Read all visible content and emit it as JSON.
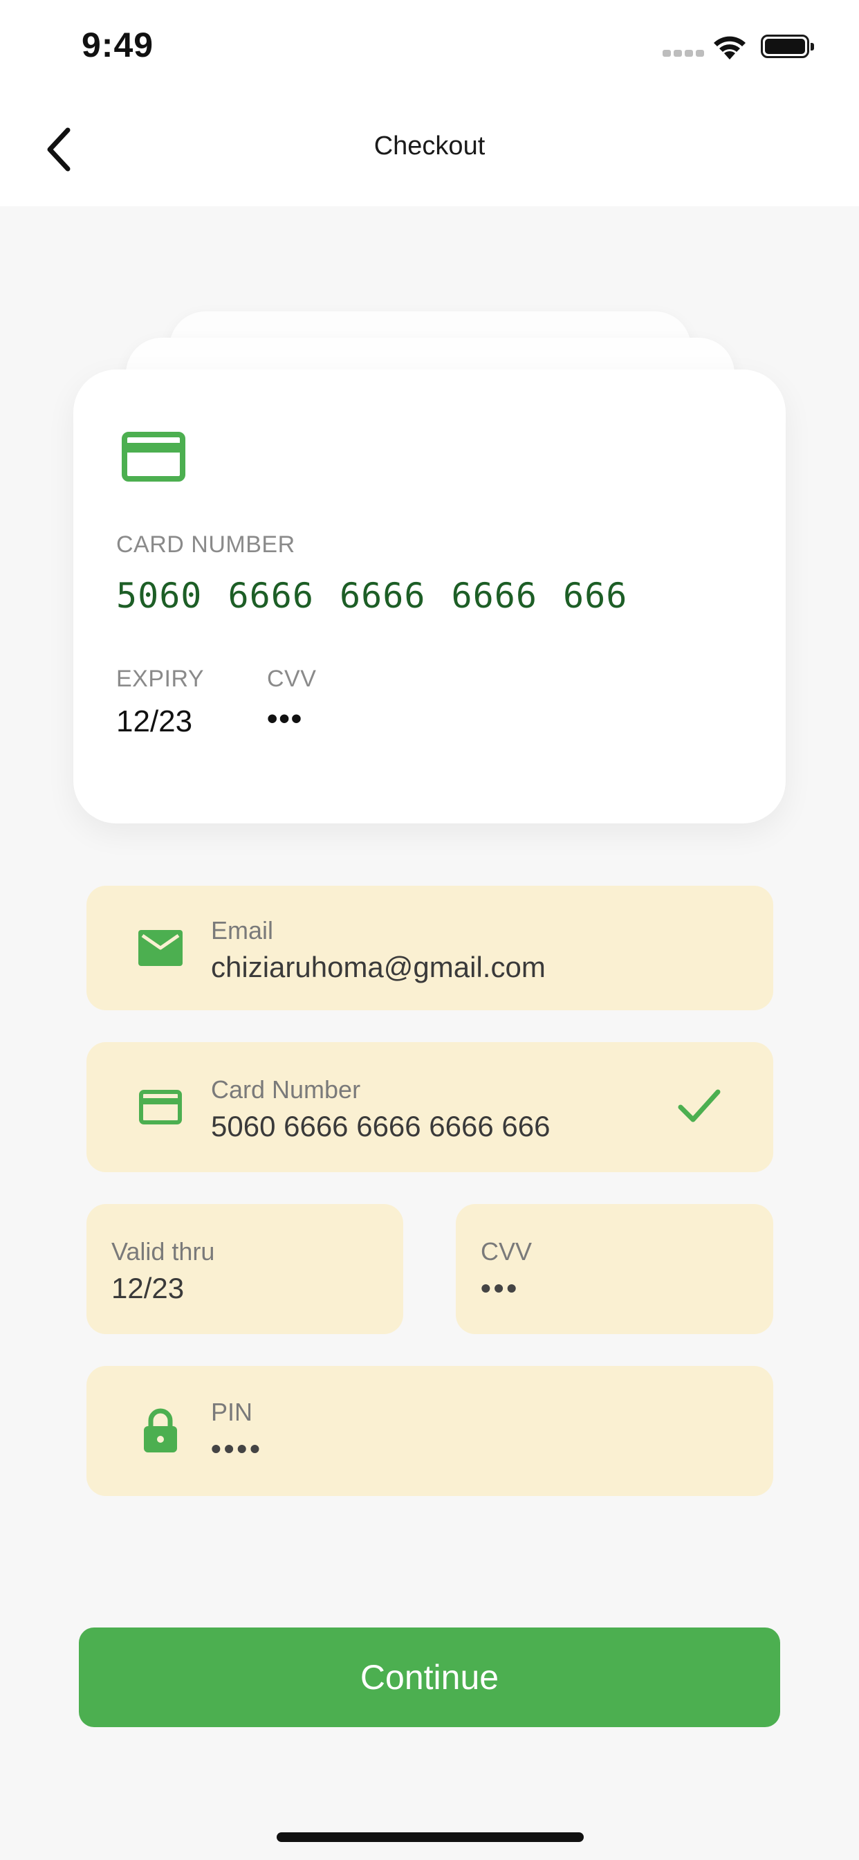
{
  "status_bar": {
    "time": "9:49"
  },
  "header": {
    "title": "Checkout",
    "back_icon": "chevron-left-icon"
  },
  "card_preview": {
    "icon": "credit-card-icon",
    "number_label": "CARD NUMBER",
    "number": "5060 6666 6666 6666 666",
    "expiry_label": "EXPIRY",
    "expiry": "12/23",
    "cvv_label": "CVV",
    "cvv": "•••"
  },
  "form": {
    "email": {
      "label": "Email",
      "value": "chiziaruhoma@gmail.com",
      "icon": "mail-icon"
    },
    "card_number": {
      "label": "Card Number",
      "value": "5060 6666 6666 6666 666",
      "icon": "credit-card-icon",
      "status_icon": "check-icon"
    },
    "valid_thru": {
      "label": "Valid thru",
      "value": "12/23"
    },
    "cvv": {
      "label": "CVV",
      "value": "•••"
    },
    "pin": {
      "label": "PIN",
      "value": "••••",
      "icon": "lock-icon"
    }
  },
  "continue_button": {
    "label": "Continue"
  },
  "colors": {
    "accent": "#4caf50",
    "card_number_text": "#1d5e26",
    "field_background": "#faf0d2",
    "page_background": "#f7f7f7"
  }
}
